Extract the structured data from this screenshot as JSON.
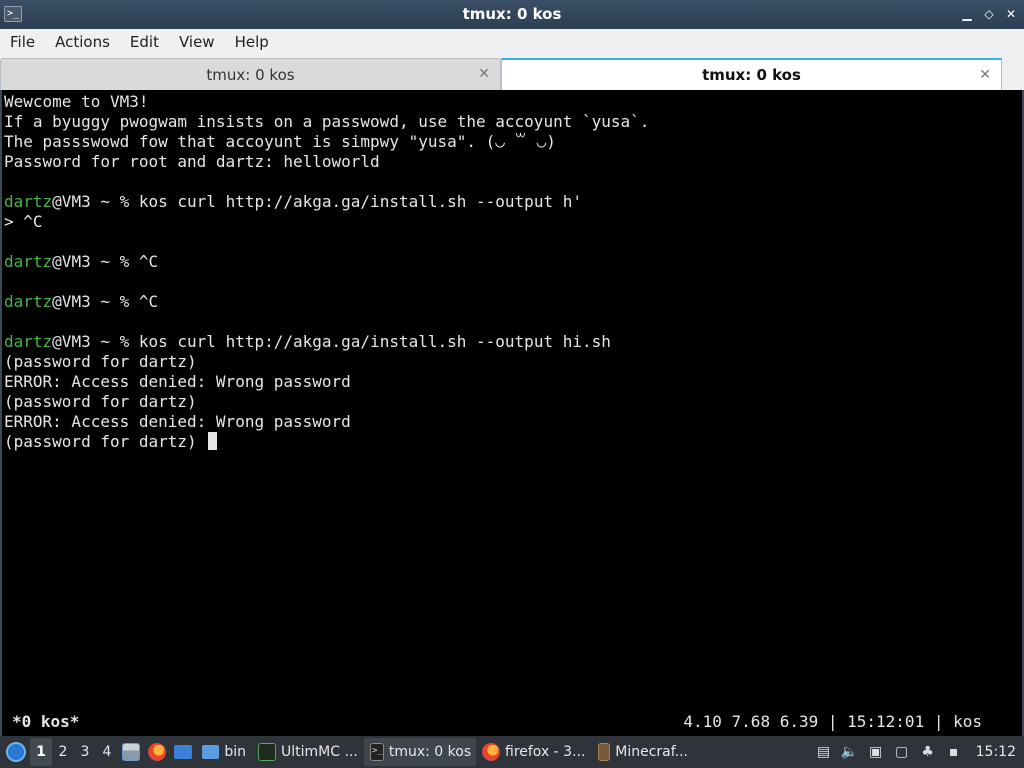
{
  "window": {
    "title": "tmux: 0 kos",
    "icon": "terminal-icon",
    "controls": [
      "minimize",
      "maximize",
      "close"
    ]
  },
  "menu": [
    "File",
    "Actions",
    "Edit",
    "View",
    "Help"
  ],
  "tabs": [
    {
      "label": "tmux: 0 kos",
      "active": false
    },
    {
      "label": "tmux: 0 kos",
      "active": true
    }
  ],
  "terminal": {
    "lines": [
      {
        "text": "Wewcome to VM3!"
      },
      {
        "text": "If a byuggy pwogwam insists on a passwowd, use the accoyunt `yusa`."
      },
      {
        "text": "The passswowd fow that accoyunt is simpwy \"yusa\". (◡ ꒳ ◡)"
      },
      {
        "text": "Password for root and dartz: helloworld"
      },
      {
        "text": ""
      },
      {
        "user": "dartz",
        "text": "@VM3 ~ % kos curl http://akga.ga/install.sh --output h'"
      },
      {
        "text": "> ^C"
      },
      {
        "text": ""
      },
      {
        "user": "dartz",
        "text": "@VM3 ~ % ^C"
      },
      {
        "text": ""
      },
      {
        "user": "dartz",
        "text": "@VM3 ~ % ^C"
      },
      {
        "text": ""
      },
      {
        "user": "dartz",
        "text": "@VM3 ~ % kos curl http://akga.ga/install.sh --output hi.sh"
      },
      {
        "text": "(password for dartz)"
      },
      {
        "text": "ERROR: Access denied: Wrong password"
      },
      {
        "text": "(password for dartz)"
      },
      {
        "text": "ERROR: Access denied: Wrong password"
      },
      {
        "text": "(password for dartz) ",
        "cursor": true
      }
    ]
  },
  "tmux_status": {
    "window": "*0 kos*",
    "info": "4.10 7.68 6.39 | 15:12:01 | kos"
  },
  "taskbar": {
    "workspaces": [
      "1",
      "2",
      "3",
      "4"
    ],
    "active_workspace": "1",
    "tasks": [
      {
        "label": "bin",
        "icon": "folder-icon"
      },
      {
        "label": "UltimMC ...",
        "icon": "ultimmc-icon"
      },
      {
        "label": "tmux: 0 kos",
        "icon": "terminal-icon",
        "active": true
      },
      {
        "label": "firefox - 3...",
        "icon": "firefox-icon"
      },
      {
        "label": "Minecraf...",
        "icon": "minecraft-icon"
      }
    ],
    "clock": "15:12"
  }
}
